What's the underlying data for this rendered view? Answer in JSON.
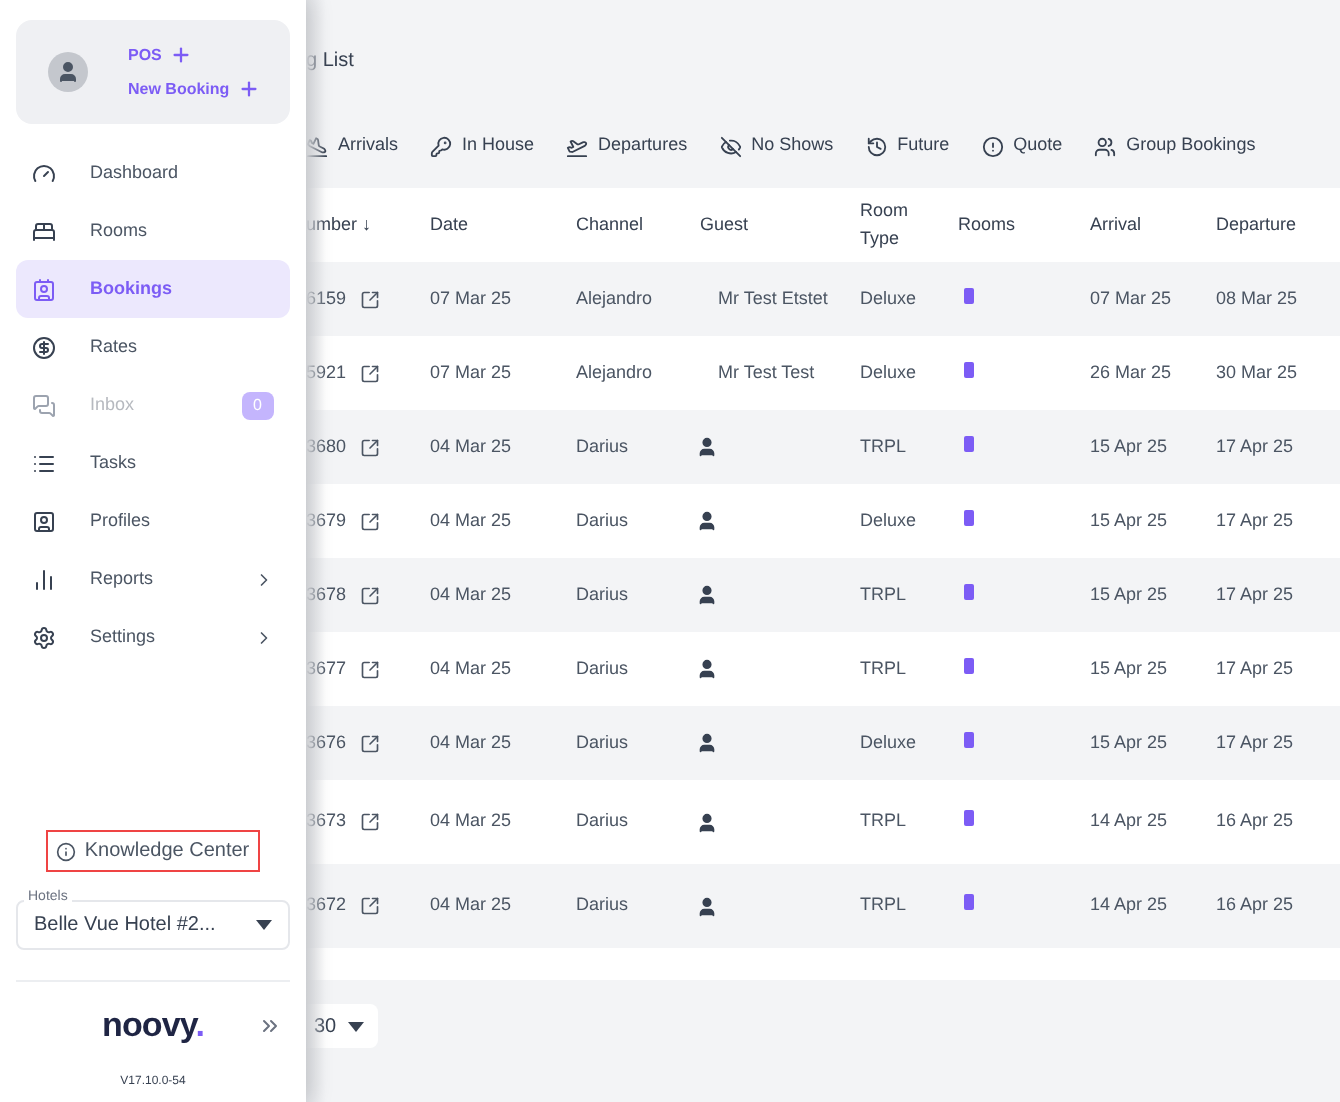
{
  "sidebar": {
    "quick_actions": [
      {
        "label": "POS"
      },
      {
        "label": "New Booking"
      }
    ],
    "items": [
      {
        "label": "Dashboard",
        "selected": false,
        "disabled": false,
        "submenu": false
      },
      {
        "label": "Rooms",
        "selected": false,
        "disabled": false,
        "submenu": false
      },
      {
        "label": "Bookings",
        "selected": true,
        "disabled": false,
        "submenu": false
      },
      {
        "label": "Rates",
        "selected": false,
        "disabled": false,
        "submenu": false
      },
      {
        "label": "Inbox",
        "selected": false,
        "disabled": true,
        "submenu": false,
        "badge": "0"
      },
      {
        "label": "Tasks",
        "selected": false,
        "disabled": false,
        "submenu": false
      },
      {
        "label": "Profiles",
        "selected": false,
        "disabled": false,
        "submenu": false
      },
      {
        "label": "Reports",
        "selected": false,
        "disabled": false,
        "submenu": true
      },
      {
        "label": "Settings",
        "selected": false,
        "disabled": false,
        "submenu": true
      }
    ],
    "knowledge_link": "Knowledge Center",
    "hotel_select": {
      "label": "Hotels",
      "value": "Belle Vue Hotel #2..."
    },
    "logo": "noovy",
    "logo_dot": ".",
    "version": "V17.10.0-54"
  },
  "page_title": "g List",
  "tabs": [
    {
      "label": "Arrivals"
    },
    {
      "label": "In House"
    },
    {
      "label": "Departures"
    },
    {
      "label": "No Shows"
    },
    {
      "label": "Future"
    },
    {
      "label": "Quote"
    },
    {
      "label": "Group Bookings"
    }
  ],
  "table": {
    "columns": [
      "umber ↓",
      "Date",
      "Channel",
      "Guest",
      "Room Type",
      "Rooms",
      "Arrival",
      "Departure"
    ],
    "rows": [
      {
        "number": "6159",
        "date": "07 Mar 25",
        "channel": "Alejandro",
        "guest": "Mr Test Etstet",
        "room_type": "Deluxe",
        "arrival": "07 Mar 25",
        "departure": "08 Mar 25"
      },
      {
        "number": "5921",
        "date": "07 Mar 25",
        "channel": "Alejandro",
        "guest": "Mr Test Test",
        "room_type": "Deluxe",
        "arrival": "26 Mar 25",
        "departure": "30 Mar 25"
      },
      {
        "number": "3680",
        "date": "04 Mar 25",
        "channel": "Darius",
        "room_type": "TRPL",
        "arrival": "15 Apr 25",
        "departure": "17 Apr 25"
      },
      {
        "number": "3679",
        "date": "04 Mar 25",
        "channel": "Darius",
        "room_type": "Deluxe",
        "arrival": "15 Apr 25",
        "departure": "17 Apr 25"
      },
      {
        "number": "3678",
        "date": "04 Mar 25",
        "channel": "Darius",
        "room_type": "TRPL",
        "arrival": "15 Apr 25",
        "departure": "17 Apr 25"
      },
      {
        "number": "3677",
        "date": "04 Mar 25",
        "channel": "Darius",
        "room_type": "TRPL",
        "arrival": "15 Apr 25",
        "departure": "17 Apr 25"
      },
      {
        "number": "3676",
        "date": "04 Mar 25",
        "channel": "Darius",
        "room_type": "Deluxe",
        "arrival": "15 Apr 25",
        "departure": "17 Apr 25"
      },
      {
        "number": "3673",
        "date": "04 Mar 25",
        "channel": "Darius",
        "room_type": "TRPL",
        "arrival": "14 Apr 25",
        "departure": "16 Apr 25"
      },
      {
        "number": "3672",
        "date": "04 Mar 25",
        "channel": "Darius",
        "room_type": "TRPL",
        "arrival": "14 Apr 25",
        "departure": "16 Apr 25"
      }
    ]
  },
  "page_size": "30"
}
